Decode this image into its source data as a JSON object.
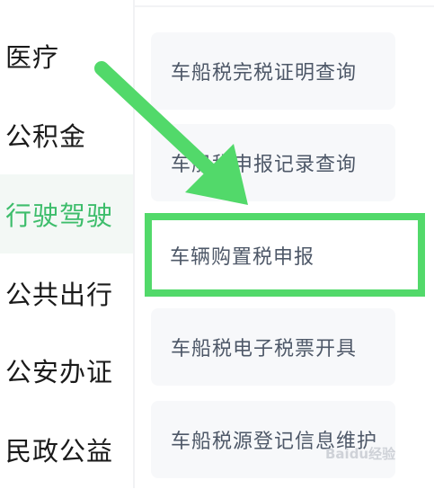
{
  "sidebar": {
    "items": [
      {
        "label": "医疗",
        "active": false
      },
      {
        "label": "公积金",
        "active": false
      },
      {
        "label": "行驶驾驶",
        "active": true
      },
      {
        "label": "公共出行",
        "active": false
      },
      {
        "label": "公安办证",
        "active": false
      },
      {
        "label": "民政公益",
        "active": false
      }
    ]
  },
  "services": [
    {
      "label": "车船税完税证明查询"
    },
    {
      "label": "车船税申报记录查询"
    },
    {
      "label": "车辆购置税申报",
      "highlighted": true
    },
    {
      "label": "车船税电子税票开具"
    },
    {
      "label": "车船税源登记信息维护"
    }
  ],
  "annotation": {
    "arrow_color": "#52d96a",
    "highlight_color": "#52d96a"
  },
  "colors": {
    "accent": "#3dbd6b",
    "item_bg": "#f7f8fa"
  },
  "watermark": {
    "text": "Baidu经验"
  }
}
